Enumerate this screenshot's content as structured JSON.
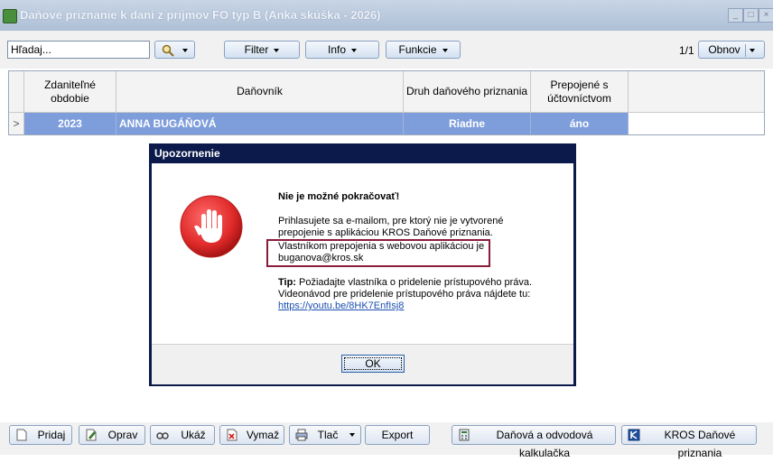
{
  "window": {
    "title": "Daňové priznanie k dani z príjmov FO typ B (Anka skúška - 2026)"
  },
  "toolbar": {
    "search_placeholder": "Hľadaj...",
    "filter_label": "Filter",
    "info_label": "Info",
    "funkcie_label": "Funkcie",
    "page_count": "1/1",
    "obnov_label": "Obnov"
  },
  "table": {
    "headers": {
      "obdobie": "Zdaniteľné obdobie",
      "danovnik": "Daňovník",
      "druh": "Druh daňového priznania",
      "prepojene": "Prepojené s účtovníctvom"
    },
    "rows": [
      {
        "pointer": ">",
        "obdobie": "2023",
        "danovnik": "ANNA BUGÁŇOVÁ",
        "druh": "Riadne",
        "prepojene": "áno"
      }
    ]
  },
  "dialog": {
    "title": "Upozornenie",
    "heading": "Nie je možné pokračovať!",
    "line1": "Prihlasujete sa e-mailom, pre ktorý nie je vytvorené",
    "line2": "prepojenie s aplikáciou KROS Daňové priznania.",
    "line3": "Vlastníkom prepojenia s webovou aplikáciou je",
    "email": "buganova@kros.sk",
    "tip_label": "Tip:",
    "tip_text": " Požiadajte vlastníka o pridelenie prístupového práva.",
    "video_text": "Videonávod pre pridelenie prístupového práva nájdete tu:",
    "link": "https://youtu.be/8HK7EnfIsj8",
    "ok_label": "OK",
    "icon": "stop-hand-icon"
  },
  "bottom": {
    "pridaj": "Pridaj",
    "oprav": "Oprav",
    "ukaz": "Ukáž",
    "vymaz": "Vymaž",
    "tlac": "Tlač",
    "export": "Export",
    "kalkulacka": "Daňová a odvodová kalkulačka",
    "kros": "KROS Daňové priznania"
  },
  "colors": {
    "selected_row": "#7d9ddb",
    "dialog_frame": "#0b1a4a",
    "highlight_box": "#8a1c3a",
    "stop_red": "#e02a2a"
  }
}
